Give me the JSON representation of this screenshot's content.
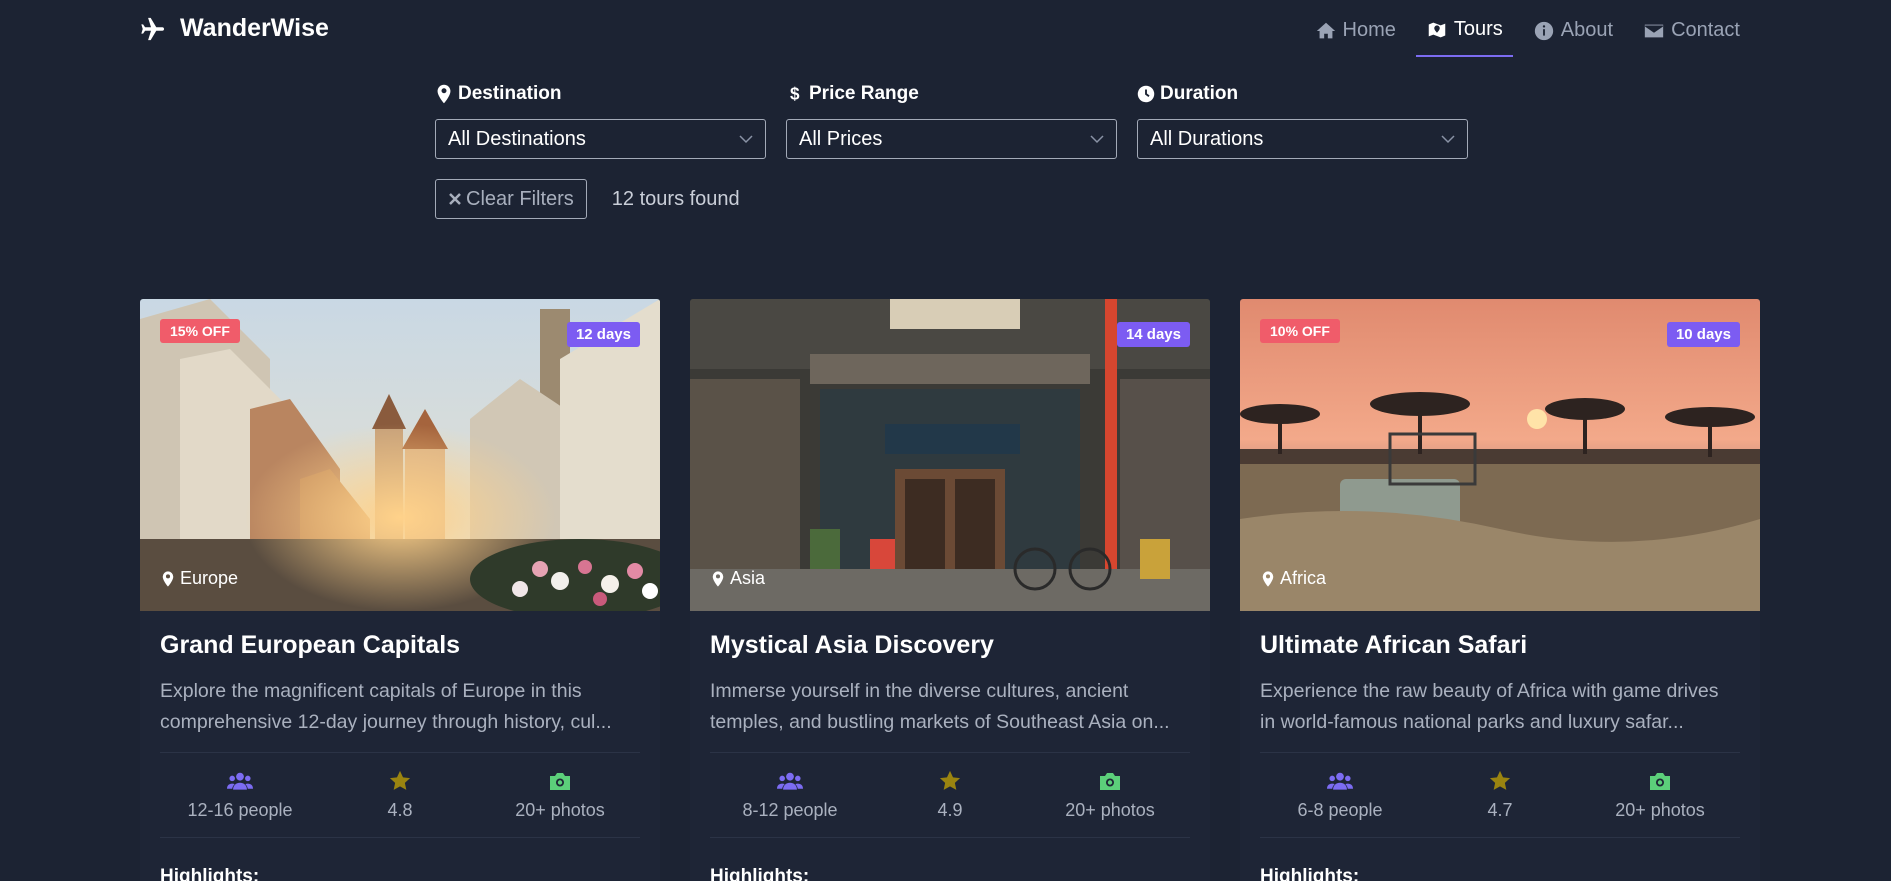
{
  "brand": {
    "name": "WanderWise",
    "icon": "plane-icon"
  },
  "nav": [
    {
      "label": "Home",
      "icon": "home-icon",
      "active": false
    },
    {
      "label": "Tours",
      "icon": "map-icon",
      "active": true
    },
    {
      "label": "About",
      "icon": "info-icon",
      "active": false
    },
    {
      "label": "Contact",
      "icon": "envelope-icon",
      "active": false
    }
  ],
  "filters": {
    "destination": {
      "label": "Destination",
      "value": "All Destinations",
      "icon": "map-pin-icon"
    },
    "price": {
      "label": "Price Range",
      "value": "All Prices",
      "icon": "dollar-icon"
    },
    "duration": {
      "label": "Duration",
      "value": "All Durations",
      "icon": "clock-icon"
    },
    "clear_label": "Clear Filters",
    "results": "12 tours found"
  },
  "tours": [
    {
      "discount": "15% OFF",
      "days": "12 days",
      "region": "Europe",
      "title": "Grand European Capitals",
      "desc_line1": "Explore the magnificent capitals of Europe in this",
      "desc_line2": "comprehensive 12-day journey through history, cul...",
      "people": "12-16 people",
      "rating": "4.8",
      "photos": "20+ photos",
      "highlights_label": "Highlights:"
    },
    {
      "discount": "",
      "days": "14 days",
      "region": "Asia",
      "title": "Mystical Asia Discovery",
      "desc_line1": "Immerse yourself in the diverse cultures, ancient",
      "desc_line2": "temples, and bustling markets of Southeast Asia on...",
      "people": "8-12 people",
      "rating": "4.9",
      "photos": "20+ photos",
      "highlights_label": "Highlights:"
    },
    {
      "discount": "10% OFF",
      "days": "10 days",
      "region": "Africa",
      "title": "Ultimate African Safari",
      "desc_line1": "Experience the raw beauty of Africa with game drives",
      "desc_line2": "in world-famous national parks and luxury safar...",
      "people": "6-8 people",
      "rating": "4.7",
      "photos": "20+ photos",
      "highlights_label": "Highlights:"
    }
  ],
  "colors": {
    "background": "#1c2333",
    "accent": "#7c5cf2",
    "discount": "#f05c6a",
    "people_icon": "#7c6cf2",
    "star_icon": "#9a8410",
    "camera_icon": "#5ccf7a"
  }
}
